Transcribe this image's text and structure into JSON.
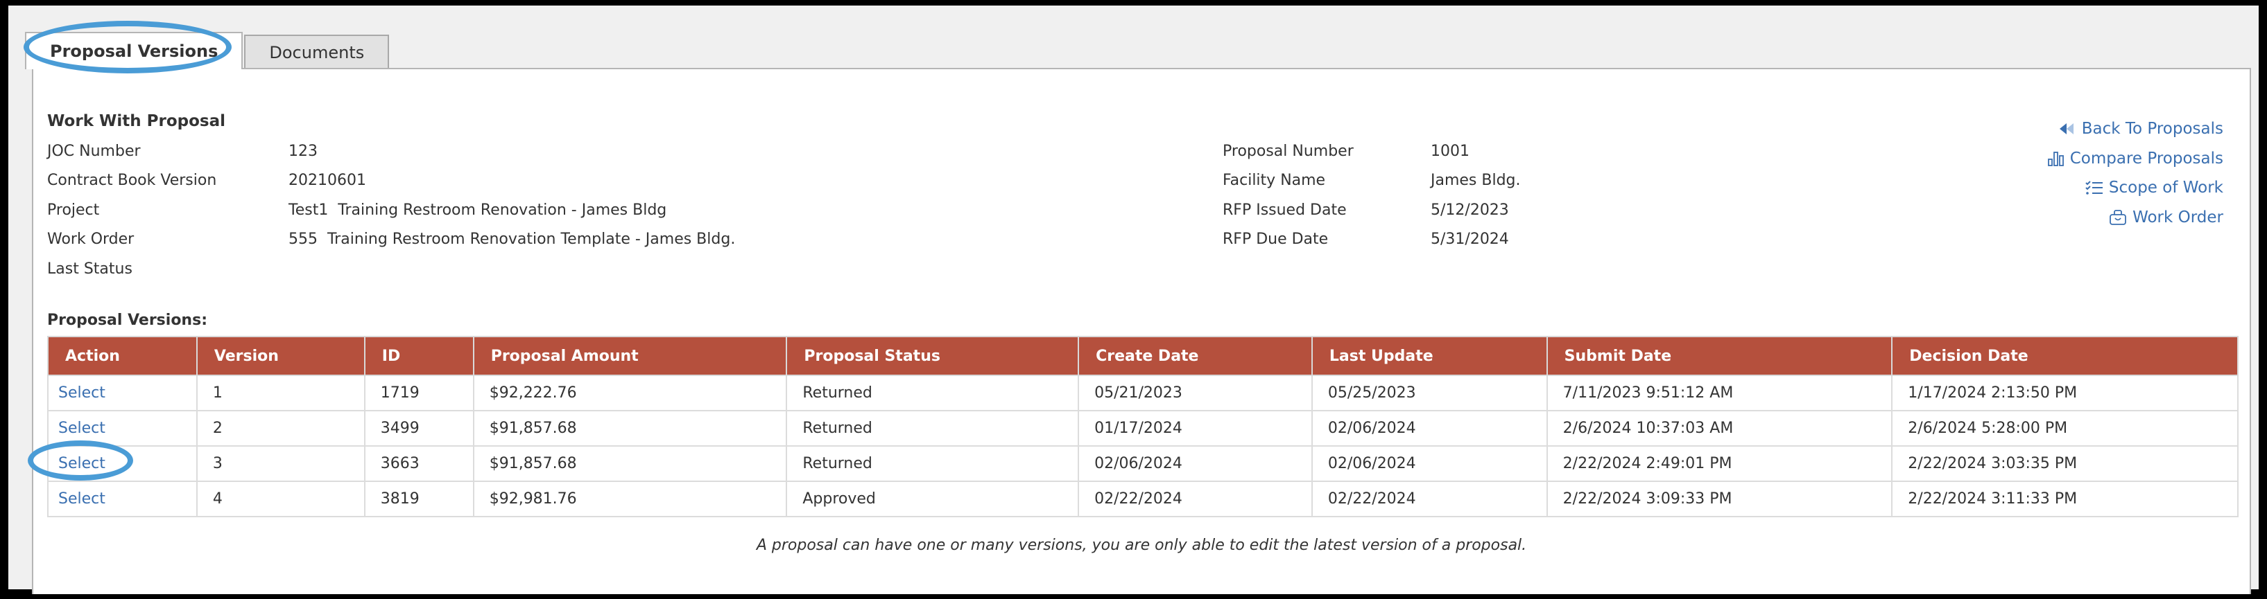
{
  "tabs": [
    {
      "label": "Proposal Versions",
      "active": true
    },
    {
      "label": "Documents",
      "active": false
    }
  ],
  "header": {
    "title": "Work With Proposal"
  },
  "details_left": [
    {
      "label": "JOC Number",
      "value": "123"
    },
    {
      "label": "Contract Book Version",
      "value": "20210601"
    },
    {
      "label": "Project",
      "value": "Test1  Training Restroom Renovation - James Bldg"
    },
    {
      "label": "Work Order",
      "value": "555  Training Restroom Renovation Template - James Bldg."
    },
    {
      "label": "Last Status",
      "value": ""
    }
  ],
  "details_right": [
    {
      "label": "Proposal Number",
      "value": "1001"
    },
    {
      "label": "Facility Name",
      "value": "James Bldg."
    },
    {
      "label": "RFP Issued Date",
      "value": "5/12/2023"
    },
    {
      "label": "RFP Due Date",
      "value": "5/31/2024"
    }
  ],
  "links": [
    {
      "label": "Back To Proposals",
      "icon": "back-rewind-icon"
    },
    {
      "label": "Compare Proposals",
      "icon": "bar-chart-icon"
    },
    {
      "label": "Scope of Work",
      "icon": "checklist-icon"
    },
    {
      "label": "Work Order",
      "icon": "briefcase-icon"
    }
  ],
  "versions": {
    "title": "Proposal Versions:",
    "columns": [
      "Action",
      "Version",
      "ID",
      "Proposal Amount",
      "Proposal Status",
      "Create Date",
      "Last Update",
      "Submit Date",
      "Decision Date"
    ],
    "rows": [
      {
        "action": "Select",
        "version": "1",
        "id": "1719",
        "amount": "$92,222.76",
        "status": "Returned",
        "create": "05/21/2023",
        "update": "05/25/2023",
        "submit": "7/11/2023 9:51:12 AM",
        "decision": "1/17/2024 2:13:50 PM"
      },
      {
        "action": "Select",
        "version": "2",
        "id": "3499",
        "amount": "$91,857.68",
        "status": "Returned",
        "create": "01/17/2024",
        "update": "02/06/2024",
        "submit": "2/6/2024 10:37:03 AM",
        "decision": "2/6/2024 5:28:00 PM"
      },
      {
        "action": "Select",
        "version": "3",
        "id": "3663",
        "amount": "$91,857.68",
        "status": "Returned",
        "create": "02/06/2024",
        "update": "02/06/2024",
        "submit": "2/22/2024 2:49:01 PM",
        "decision": "2/22/2024 3:03:35 PM"
      },
      {
        "action": "Select",
        "version": "4",
        "id": "3819",
        "amount": "$92,981.76",
        "status": "Approved",
        "create": "02/22/2024",
        "update": "02/22/2024",
        "submit": "2/22/2024 3:09:33 PM",
        "decision": "2/22/2024 3:11:33 PM"
      }
    ]
  },
  "footnote": "A proposal can have one or many versions, you are only able to edit the latest version of a proposal.",
  "colors": {
    "header_bg": "#b5503d",
    "link": "#3a6fb0",
    "annotation": "#4a9cd6"
  }
}
